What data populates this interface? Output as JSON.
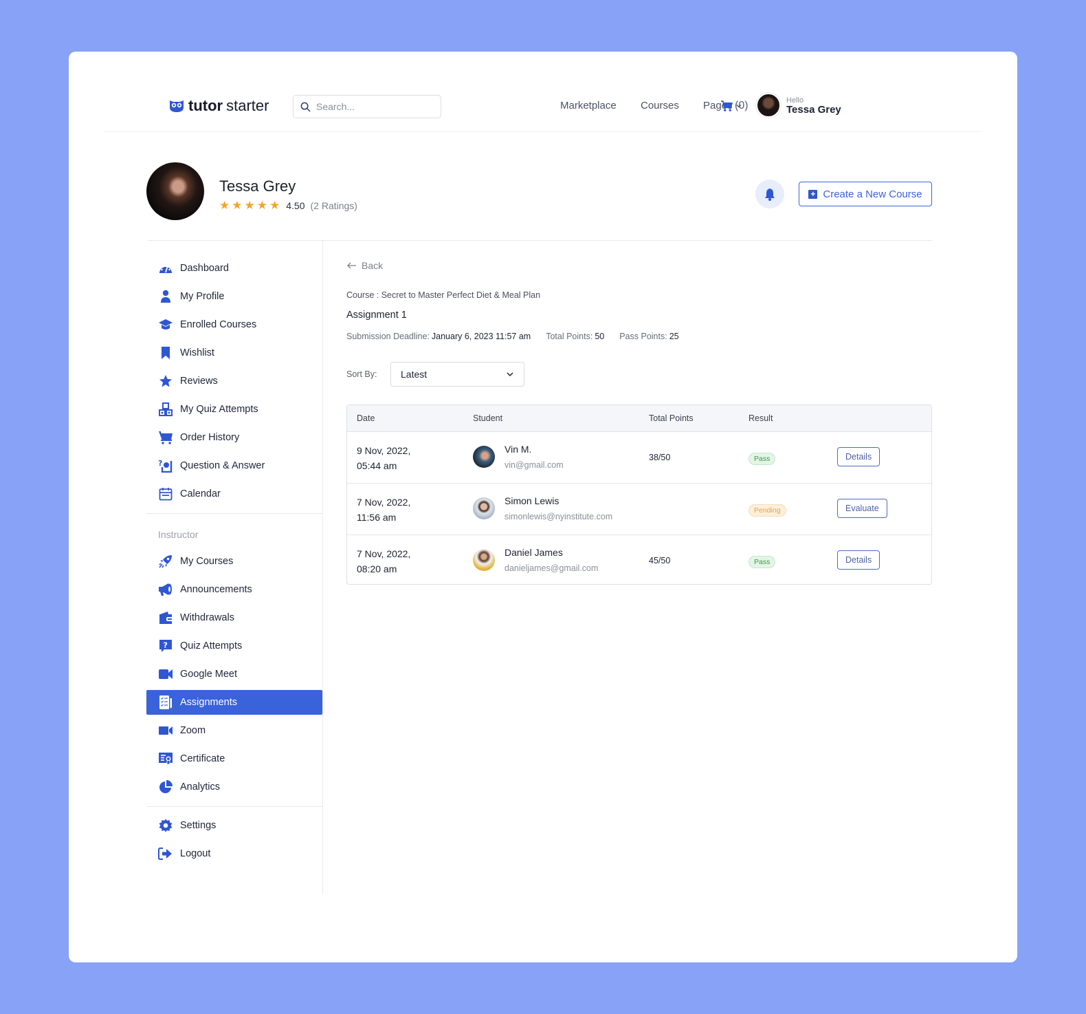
{
  "header": {
    "logo_bold": "tutor",
    "logo_light": "starter",
    "search_placeholder": "Search...",
    "nav": [
      "Marketplace",
      "Courses",
      "Pages"
    ],
    "cart_count": "(0)",
    "greeting": "Hello",
    "user_name": "Tessa Grey"
  },
  "profile": {
    "name": "Tessa Grey",
    "stars": 5,
    "rating": "4.50",
    "rating_count": "(2 Ratings)",
    "create_course_label": "Create a New Course"
  },
  "sidebar": {
    "items": [
      {
        "label": "Dashboard",
        "icon": "dashboard-icon"
      },
      {
        "label": "My Profile",
        "icon": "user-icon"
      },
      {
        "label": "Enrolled Courses",
        "icon": "graduation-cap-icon"
      },
      {
        "label": "Wishlist",
        "icon": "bookmark-icon"
      },
      {
        "label": "Reviews",
        "icon": "star-icon"
      },
      {
        "label": "My Quiz Attempts",
        "icon": "quiz-blocks-icon"
      },
      {
        "label": "Order History",
        "icon": "cart-icon"
      },
      {
        "label": "Question & Answer",
        "icon": "question-answer-icon"
      },
      {
        "label": "Calendar",
        "icon": "calendar-icon"
      }
    ],
    "instructor_heading": "Instructor",
    "instructor_items": [
      {
        "label": "My Courses",
        "icon": "rocket-icon"
      },
      {
        "label": "Announcements",
        "icon": "megaphone-icon"
      },
      {
        "label": "Withdrawals",
        "icon": "wallet-icon"
      },
      {
        "label": "Quiz Attempts",
        "icon": "quiz-question-icon"
      },
      {
        "label": "Google Meet",
        "icon": "video-camera-icon"
      },
      {
        "label": "Assignments",
        "icon": "assignment-list-icon",
        "active": true
      },
      {
        "label": "Zoom",
        "icon": "zoom-camera-icon"
      },
      {
        "label": "Certificate",
        "icon": "certificate-icon"
      },
      {
        "label": "Analytics",
        "icon": "pie-chart-icon"
      }
    ],
    "bottom_items": [
      {
        "label": "Settings",
        "icon": "gear-icon"
      },
      {
        "label": "Logout",
        "icon": "logout-icon"
      }
    ]
  },
  "main": {
    "back_label": "Back",
    "course_line": "Course : Secret to Master Perfect Diet & Meal Plan",
    "assignment_title": "Assignment 1",
    "deadline_label": "Submission Deadline:",
    "deadline_value": "January 6, 2023 11:57 am",
    "total_points_label": "Total Points:",
    "total_points_value": "50",
    "pass_points_label": "Pass Points:",
    "pass_points_value": "25",
    "sort_label": "Sort By:",
    "sort_value": "Latest",
    "table": {
      "headers": [
        "Date",
        "Student",
        "Total Points",
        "Result"
      ],
      "rows": [
        {
          "date_line1": "9 Nov, 2022,",
          "date_line2": "05:44 am",
          "name": "Vin M.",
          "email": "vin@gmail.com",
          "points": "38/50",
          "result": "Pass",
          "action": "Details"
        },
        {
          "date_line1": "7 Nov, 2022,",
          "date_line2": "11:56 am",
          "name": "Simon Lewis",
          "email": "simonlewis@nyinstitute.com",
          "points": "",
          "result": "Pending",
          "action": "Evaluate"
        },
        {
          "date_line1": "7 Nov, 2022,",
          "date_line2": "08:20 am",
          "name": "Daniel James",
          "email": "danieljames@gmail.com",
          "points": "45/50",
          "result": "Pass",
          "action": "Details"
        }
      ]
    }
  },
  "colors": {
    "accent": "#3a62db",
    "background": "#87a2f6",
    "pass": "#3d9a4d",
    "pending": "#e2a34b",
    "star": "#f4a524"
  }
}
